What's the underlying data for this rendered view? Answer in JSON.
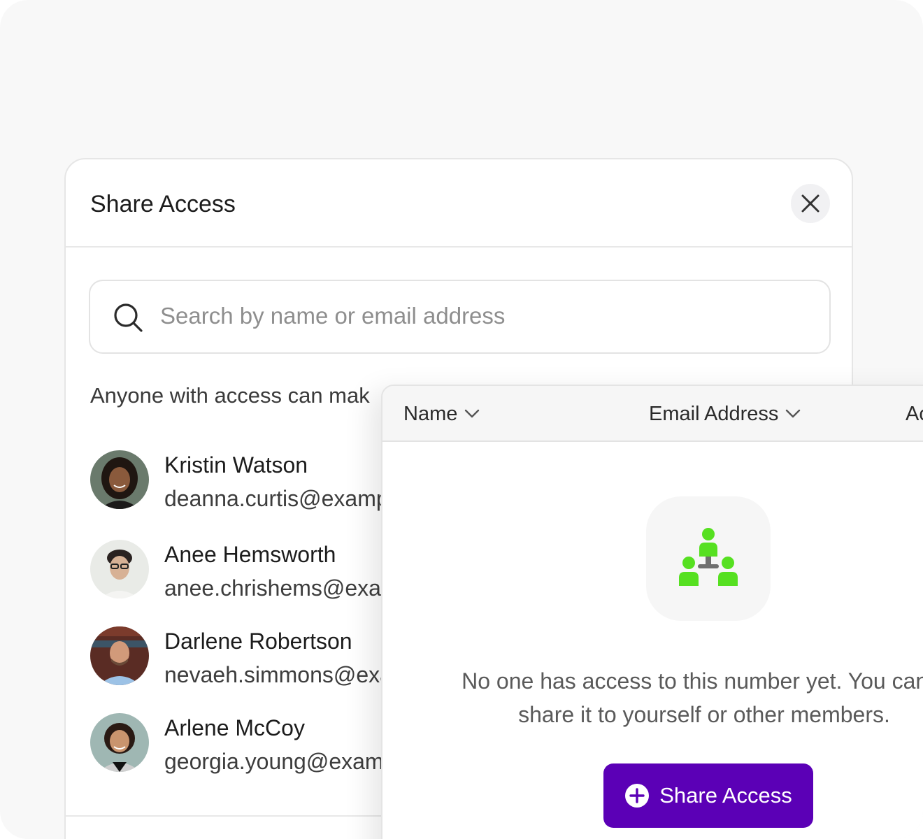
{
  "modal": {
    "title": "Share Access",
    "close_icon": "close-icon",
    "search": {
      "placeholder": "Search by name or email address",
      "icon": "search-icon"
    },
    "note": "Anyone with access can mak",
    "members": [
      {
        "name": "Kristin Watson",
        "email": "deanna.curtis@examp"
      },
      {
        "name": "Anee Hemsworth",
        "email": "anee.chrishems@exar"
      },
      {
        "name": "Darlene Robertson",
        "email": "nevaeh.simmons@exa"
      },
      {
        "name": "Arlene McCoy",
        "email": "georgia.young@exam"
      }
    ]
  },
  "panel": {
    "columns": [
      {
        "label": "Name",
        "icon": "chevron-down-icon"
      },
      {
        "label": "Email Address",
        "icon": "chevron-down-icon"
      },
      {
        "label": "Ac"
      }
    ],
    "empty_state": {
      "icon": "org-chart-people-icon",
      "line1": "No one has access to this number yet. You can e",
      "line2": "share it to yourself or other members."
    },
    "share_button": {
      "label": "Share Access",
      "icon": "plus-circle-icon"
    }
  },
  "colors": {
    "accent": "#5b00b6",
    "illustration": "#56e021",
    "background": "#f8f8f8"
  }
}
